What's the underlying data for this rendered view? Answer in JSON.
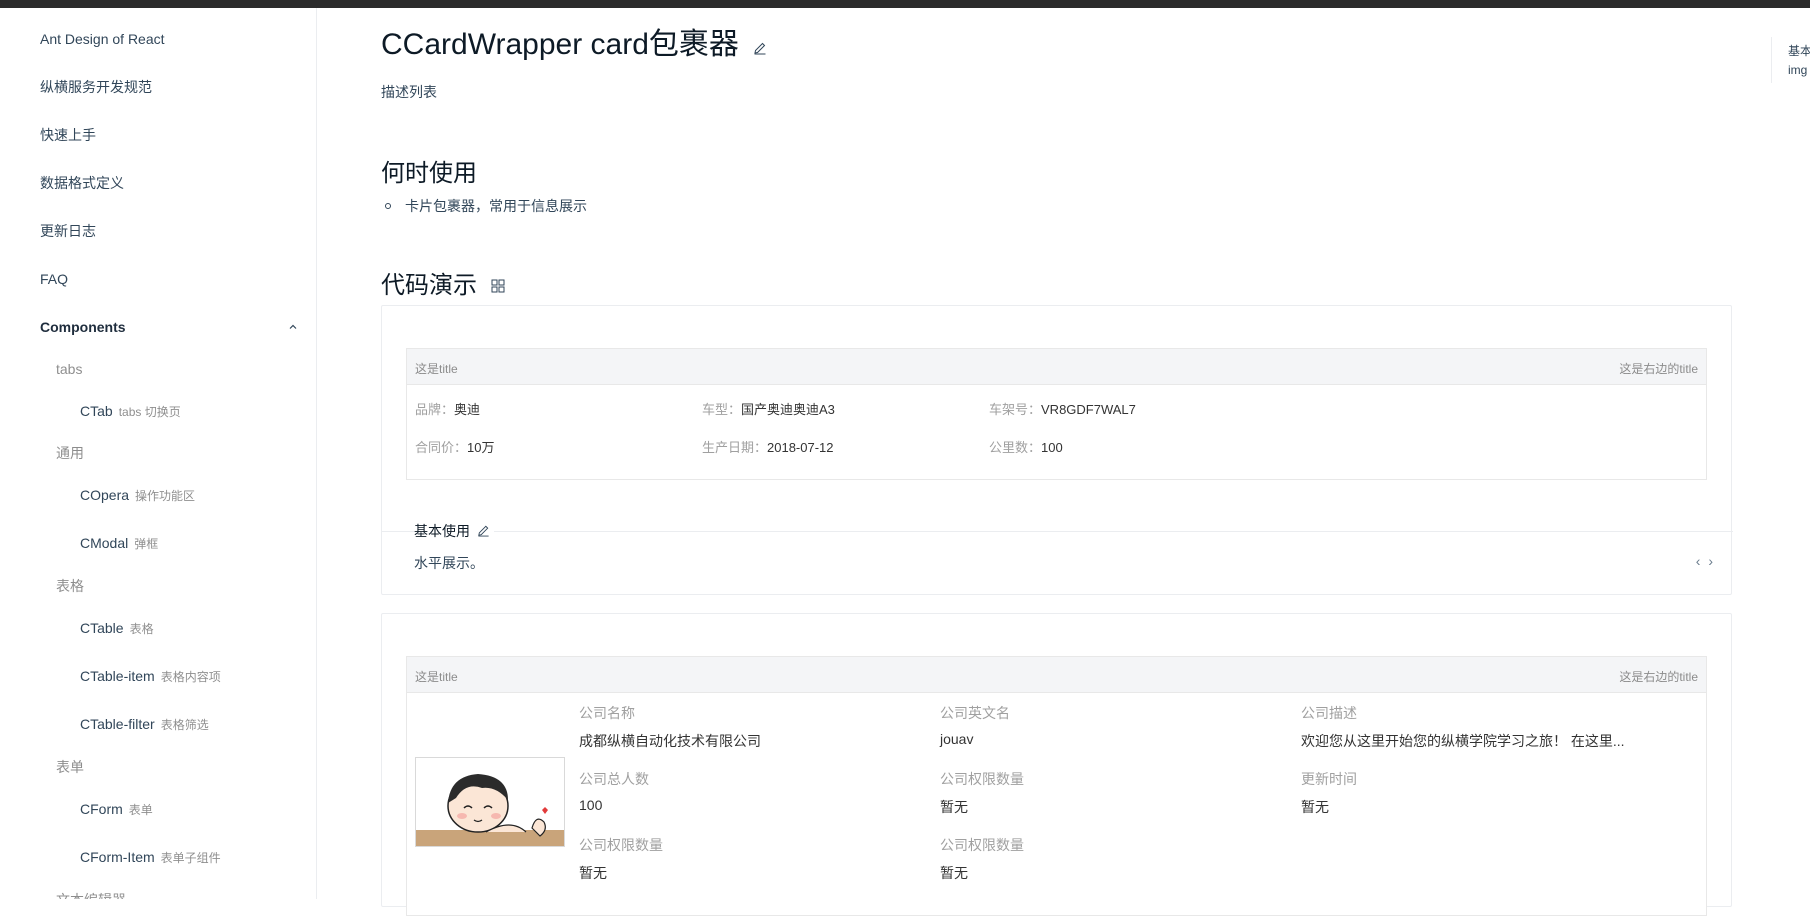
{
  "sidebar": {
    "items": [
      {
        "label": "Ant Design of React"
      },
      {
        "label": "纵横服务开发规范"
      },
      {
        "label": "快速上手"
      },
      {
        "label": "数据格式定义"
      },
      {
        "label": "更新日志"
      },
      {
        "label": "FAQ"
      }
    ],
    "group": {
      "label": "Components",
      "expanded": true
    },
    "sections": [
      {
        "title": "tabs",
        "leaves": [
          {
            "name": "CTab",
            "desc": "tabs 切换页"
          }
        ]
      },
      {
        "title": "通用",
        "leaves": [
          {
            "name": "COpera",
            "desc": "操作功能区"
          },
          {
            "name": "CModal",
            "desc": "弹框"
          }
        ]
      },
      {
        "title": "表格",
        "leaves": [
          {
            "name": "CTable",
            "desc": "表格"
          },
          {
            "name": "CTable-item",
            "desc": "表格内容项"
          },
          {
            "name": "CTable-filter",
            "desc": "表格筛选"
          }
        ]
      },
      {
        "title": "表单",
        "leaves": [
          {
            "name": "CForm",
            "desc": "表单"
          },
          {
            "name": "CForm-Item",
            "desc": "表单子组件"
          }
        ]
      }
    ],
    "cut_off_item": "文本编辑器"
  },
  "page": {
    "title": "CCardWrapper card包裹器",
    "description": "描述列表",
    "when_to_use": "何时使用",
    "when_bullet": "卡片包裹器，常用于信息展示",
    "demo_heading": "代码演示"
  },
  "demo1": {
    "card_title": "这是title",
    "card_right_title": "这是右边的title",
    "fields": [
      {
        "k": "品牌：",
        "v": "奥迪"
      },
      {
        "k": "车型：",
        "v": "国产奥迪奥迪A3"
      },
      {
        "k": "车架号：",
        "v": "VR8GDF7WAL7"
      },
      {
        "k": "合同价：",
        "v": "10万"
      },
      {
        "k": "生产日期：",
        "v": "2018-07-12"
      },
      {
        "k": "公里数：",
        "v": "100"
      }
    ],
    "meta_title": "基本使用",
    "meta_desc": "水平展示。",
    "code_toggle": "‹ ›"
  },
  "demo2": {
    "card_title": "这是title",
    "card_right_title": "这是右边的title",
    "fields": [
      {
        "label": "公司名称",
        "value": "成都纵横自动化技术有限公司"
      },
      {
        "label": "公司英文名",
        "value": "jouav"
      },
      {
        "label": "公司描述",
        "value": "欢迎您从这里开始您的纵横学院学习之旅！ 在这里..."
      },
      {
        "label": "公司总人数",
        "value": "100"
      },
      {
        "label": "公司权限数量",
        "value": "暂无"
      },
      {
        "label": "更新时间",
        "value": "暂无"
      },
      {
        "label": "公司权限数量",
        "value": "暂无"
      },
      {
        "label": "公司权限数量",
        "value": "暂无"
      }
    ]
  },
  "anchor": {
    "line1": "基本",
    "line2": "img"
  },
  "colors": {
    "topbar": "#2b2b2b",
    "title": "#0d1a26",
    "text": "#314659",
    "muted": "#a0a0a0",
    "card_head": "#f4f5f7"
  }
}
